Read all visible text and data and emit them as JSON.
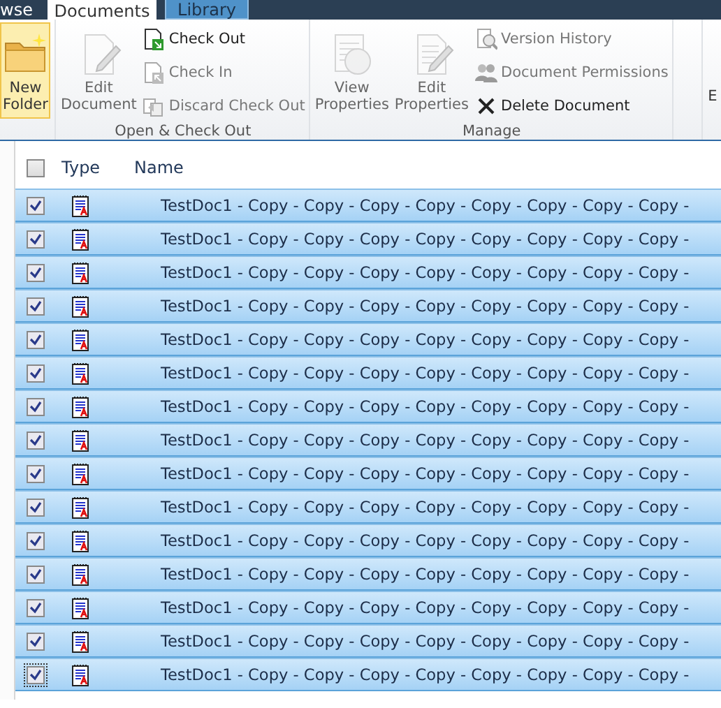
{
  "tabs": [
    {
      "label": "wse",
      "selected": false
    },
    {
      "label": "Documents",
      "selected": true
    },
    {
      "label": "Library",
      "selected": false
    }
  ],
  "ribbon": {
    "groups": [
      {
        "buttons": [
          {
            "kind": "large",
            "label": "New Folder",
            "disabled": false,
            "highlighted": true
          }
        ]
      },
      {
        "label": "Open & Check Out",
        "buttons": [
          {
            "kind": "large",
            "label": "Edit Document",
            "disabled": true,
            "highlighted": false
          },
          {
            "kind": "small",
            "label": "Check Out",
            "disabled": false,
            "highlighted": false
          },
          {
            "kind": "small",
            "label": "Check In",
            "disabled": true,
            "highlighted": false
          },
          {
            "kind": "small",
            "label": "Discard Check Out",
            "disabled": true,
            "highlighted": false
          }
        ]
      },
      {
        "label": "Manage",
        "buttons": [
          {
            "kind": "large",
            "label": "View Properties",
            "disabled": true,
            "highlighted": false
          },
          {
            "kind": "large",
            "label": "Edit Properties",
            "disabled": true,
            "highlighted": false
          },
          {
            "kind": "small",
            "label": "Version History",
            "disabled": true,
            "highlighted": false
          },
          {
            "kind": "small",
            "label": "Document Permissions",
            "disabled": true,
            "highlighted": false
          },
          {
            "kind": "small",
            "label": "Delete Document",
            "disabled": false,
            "highlighted": false
          }
        ]
      },
      {
        "buttons": [
          {
            "kind": "large",
            "label": "E",
            "disabled": false,
            "highlighted": false
          }
        ]
      }
    ]
  },
  "table": {
    "select_all": {
      "checked": false
    },
    "columns": [
      "Type",
      "Name"
    ],
    "rows": [
      {
        "name": "TestDoc1 - Copy - Copy - Copy - Copy - Copy - Copy - Copy - Copy -",
        "checked": true,
        "selected": true,
        "focused": false
      },
      {
        "name": "TestDoc1 - Copy - Copy - Copy - Copy - Copy - Copy - Copy - Copy -",
        "checked": true,
        "selected": true,
        "focused": false
      },
      {
        "name": "TestDoc1 - Copy - Copy - Copy - Copy - Copy - Copy - Copy - Copy -",
        "checked": true,
        "selected": true,
        "focused": false
      },
      {
        "name": "TestDoc1 - Copy - Copy - Copy - Copy - Copy - Copy - Copy - Copy -",
        "checked": true,
        "selected": true,
        "focused": false
      },
      {
        "name": "TestDoc1 - Copy - Copy - Copy - Copy - Copy - Copy - Copy - Copy -",
        "checked": true,
        "selected": true,
        "focused": false
      },
      {
        "name": "TestDoc1 - Copy - Copy - Copy - Copy - Copy - Copy - Copy - Copy -",
        "checked": true,
        "selected": true,
        "focused": false
      },
      {
        "name": "TestDoc1 - Copy - Copy - Copy - Copy - Copy - Copy - Copy - Copy -",
        "checked": true,
        "selected": true,
        "focused": false
      },
      {
        "name": "TestDoc1 - Copy - Copy - Copy - Copy - Copy - Copy - Copy - Copy -",
        "checked": true,
        "selected": true,
        "focused": false
      },
      {
        "name": "TestDoc1 - Copy - Copy - Copy - Copy - Copy - Copy - Copy - Copy -",
        "checked": true,
        "selected": true,
        "focused": false
      },
      {
        "name": "TestDoc1 - Copy - Copy - Copy - Copy - Copy - Copy - Copy - Copy -",
        "checked": true,
        "selected": true,
        "focused": false
      },
      {
        "name": "TestDoc1 - Copy - Copy - Copy - Copy - Copy - Copy - Copy - Copy -",
        "checked": true,
        "selected": true,
        "focused": false
      },
      {
        "name": "TestDoc1 - Copy - Copy - Copy - Copy - Copy - Copy - Copy - Copy -",
        "checked": true,
        "selected": true,
        "focused": false
      },
      {
        "name": "TestDoc1 - Copy - Copy - Copy - Copy - Copy - Copy - Copy - Copy -",
        "checked": true,
        "selected": true,
        "focused": false
      },
      {
        "name": "TestDoc1 - Copy - Copy - Copy - Copy - Copy - Copy - Copy - Copy -",
        "checked": true,
        "selected": true,
        "focused": false
      },
      {
        "name": "TestDoc1 - Copy - Copy - Copy - Copy - Copy - Copy - Copy - Copy -",
        "checked": true,
        "selected": true,
        "focused": true
      }
    ]
  }
}
